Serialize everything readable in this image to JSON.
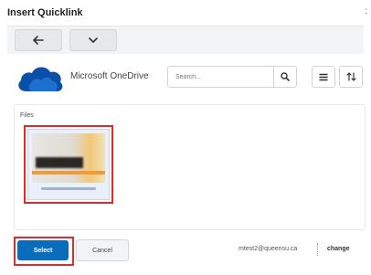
{
  "dialog": {
    "title": "Insert Quicklink",
    "close_glyph": ":"
  },
  "toolbar": {
    "back_icon": "arrow-left-icon",
    "dropdown_icon": "chevron-down-icon"
  },
  "provider": {
    "name": "Microsoft OneDrive",
    "logo_icon": "onedrive-cloud-icon",
    "logo_color": "#0a4fa8"
  },
  "search": {
    "placeholder": "Search...",
    "button_icon": "search-icon"
  },
  "view_controls": {
    "menu_icon": "list-icon",
    "sort_icon": "sort-icon"
  },
  "files": {
    "label": "Files",
    "items": [
      {
        "name": "",
        "thumbnail_icon": "file-thumbnail"
      }
    ]
  },
  "footer": {
    "select_label": "Select",
    "cancel_label": "Cancel",
    "account_email": "mtest2@queensu.ca",
    "change_label": "change"
  },
  "colors": {
    "primary": "#0a6cbd",
    "highlight": "#e32a2a"
  }
}
